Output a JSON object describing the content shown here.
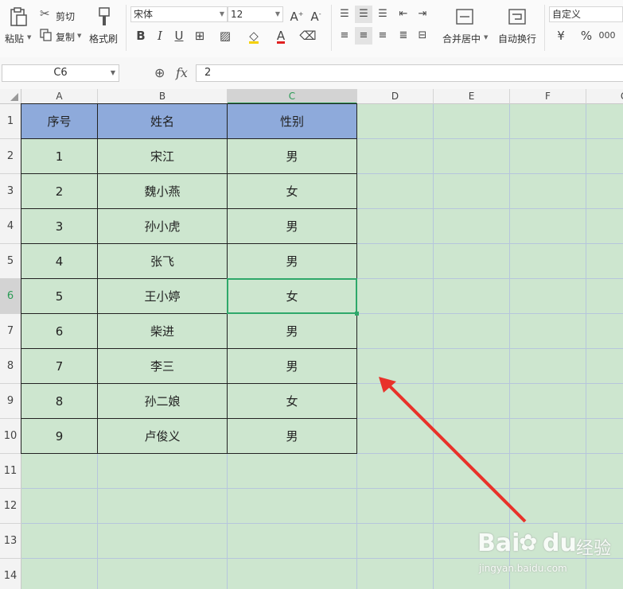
{
  "ribbon": {
    "paste": "粘贴",
    "cut": "剪切",
    "copy": "复制",
    "format_painter": "格式刷",
    "font_name": "宋体",
    "font_size": "12",
    "merge_center": "合并居中",
    "wrap_text": "自动换行",
    "number_format": "自定义",
    "currency_symbol": "¥",
    "percent_symbol": "%"
  },
  "formula_bar": {
    "name_box": "C6",
    "fx_label": "fx",
    "value": "2"
  },
  "columns": [
    "A",
    "B",
    "C",
    "D",
    "E",
    "F",
    "G"
  ],
  "rows": [
    "1",
    "2",
    "3",
    "4",
    "5",
    "6",
    "7",
    "8",
    "9",
    "10",
    "11",
    "12",
    "13",
    "14"
  ],
  "table": {
    "headers": [
      "序号",
      "姓名",
      "性别"
    ],
    "rows": [
      [
        "1",
        "宋江",
        "男"
      ],
      [
        "2",
        "魏小燕",
        "女"
      ],
      [
        "3",
        "孙小虎",
        "男"
      ],
      [
        "4",
        "张飞",
        "男"
      ],
      [
        "5",
        "王小婷",
        "女"
      ],
      [
        "6",
        "柴进",
        "男"
      ],
      [
        "7",
        "李三",
        "男"
      ],
      [
        "8",
        "孙二娘",
        "女"
      ],
      [
        "9",
        "卢俊义",
        "男"
      ]
    ]
  },
  "selection": {
    "cell": "C6",
    "column": "C",
    "row": "6"
  },
  "watermark": {
    "brand": "Bai",
    "brand_suffix": "经验",
    "url": "jingyan.baidu.com"
  },
  "colors": {
    "header_fill": "#8eaadb",
    "sheet_bg": "#cde6cf",
    "selection": "#2ea86a",
    "arrow": "#e8322a"
  }
}
